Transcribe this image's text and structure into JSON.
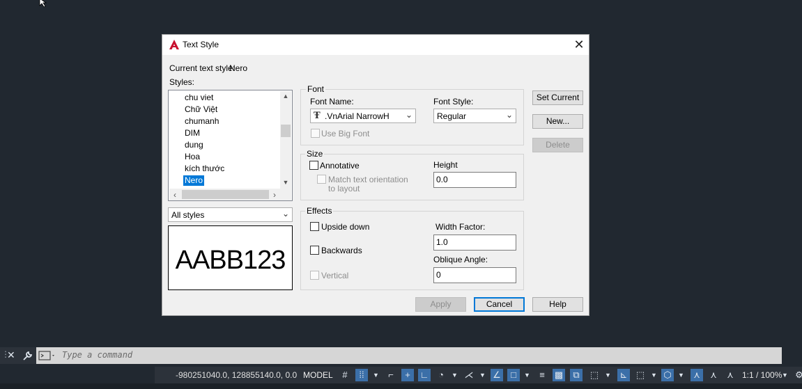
{
  "dialog": {
    "title": "Text Style",
    "current_style_label": "Current text style:",
    "current_style_value": "Nero",
    "styles_label": "Styles:",
    "styles": [
      "chu viet",
      "Chữ Việt",
      "chumanh",
      "DIM",
      "dung",
      "Hoa",
      "kích thước",
      "Nero"
    ],
    "selected_style": "Nero",
    "filter_value": "All styles",
    "preview_text": "AABB123",
    "font": {
      "group_title": "Font",
      "font_name_label": "Font Name:",
      "font_name_value": ".VnArial NarrowH",
      "font_style_label": "Font Style:",
      "font_style_value": "Regular",
      "use_big_font_label": "Use Big Font"
    },
    "size": {
      "group_title": "Size",
      "annotative_label": "Annotative",
      "match_orientation_label_1": "Match text orientation",
      "match_orientation_label_2": "to layout",
      "height_label": "Height",
      "height_value": "0.0"
    },
    "effects": {
      "group_title": "Effects",
      "upside_down_label": "Upside down",
      "backwards_label": "Backwards",
      "vertical_label": "Vertical",
      "width_factor_label": "Width Factor:",
      "width_factor_value": "1.0",
      "oblique_angle_label": "Oblique Angle:",
      "oblique_angle_value": "0"
    },
    "buttons": {
      "set_current": "Set Current",
      "new": "New...",
      "delete": "Delete",
      "apply": "Apply",
      "cancel": "Cancel",
      "help": "Help"
    }
  },
  "command_line": {
    "placeholder": "Type a command"
  },
  "status_bar": {
    "coordinates": "-980251040.0, 128855140.0, 0.0",
    "model": "MODEL",
    "scale": "1:1 / 100%"
  },
  "colors": {
    "background": "#212830",
    "selection": "#0078d7",
    "status_active": "#3b6fa8"
  }
}
